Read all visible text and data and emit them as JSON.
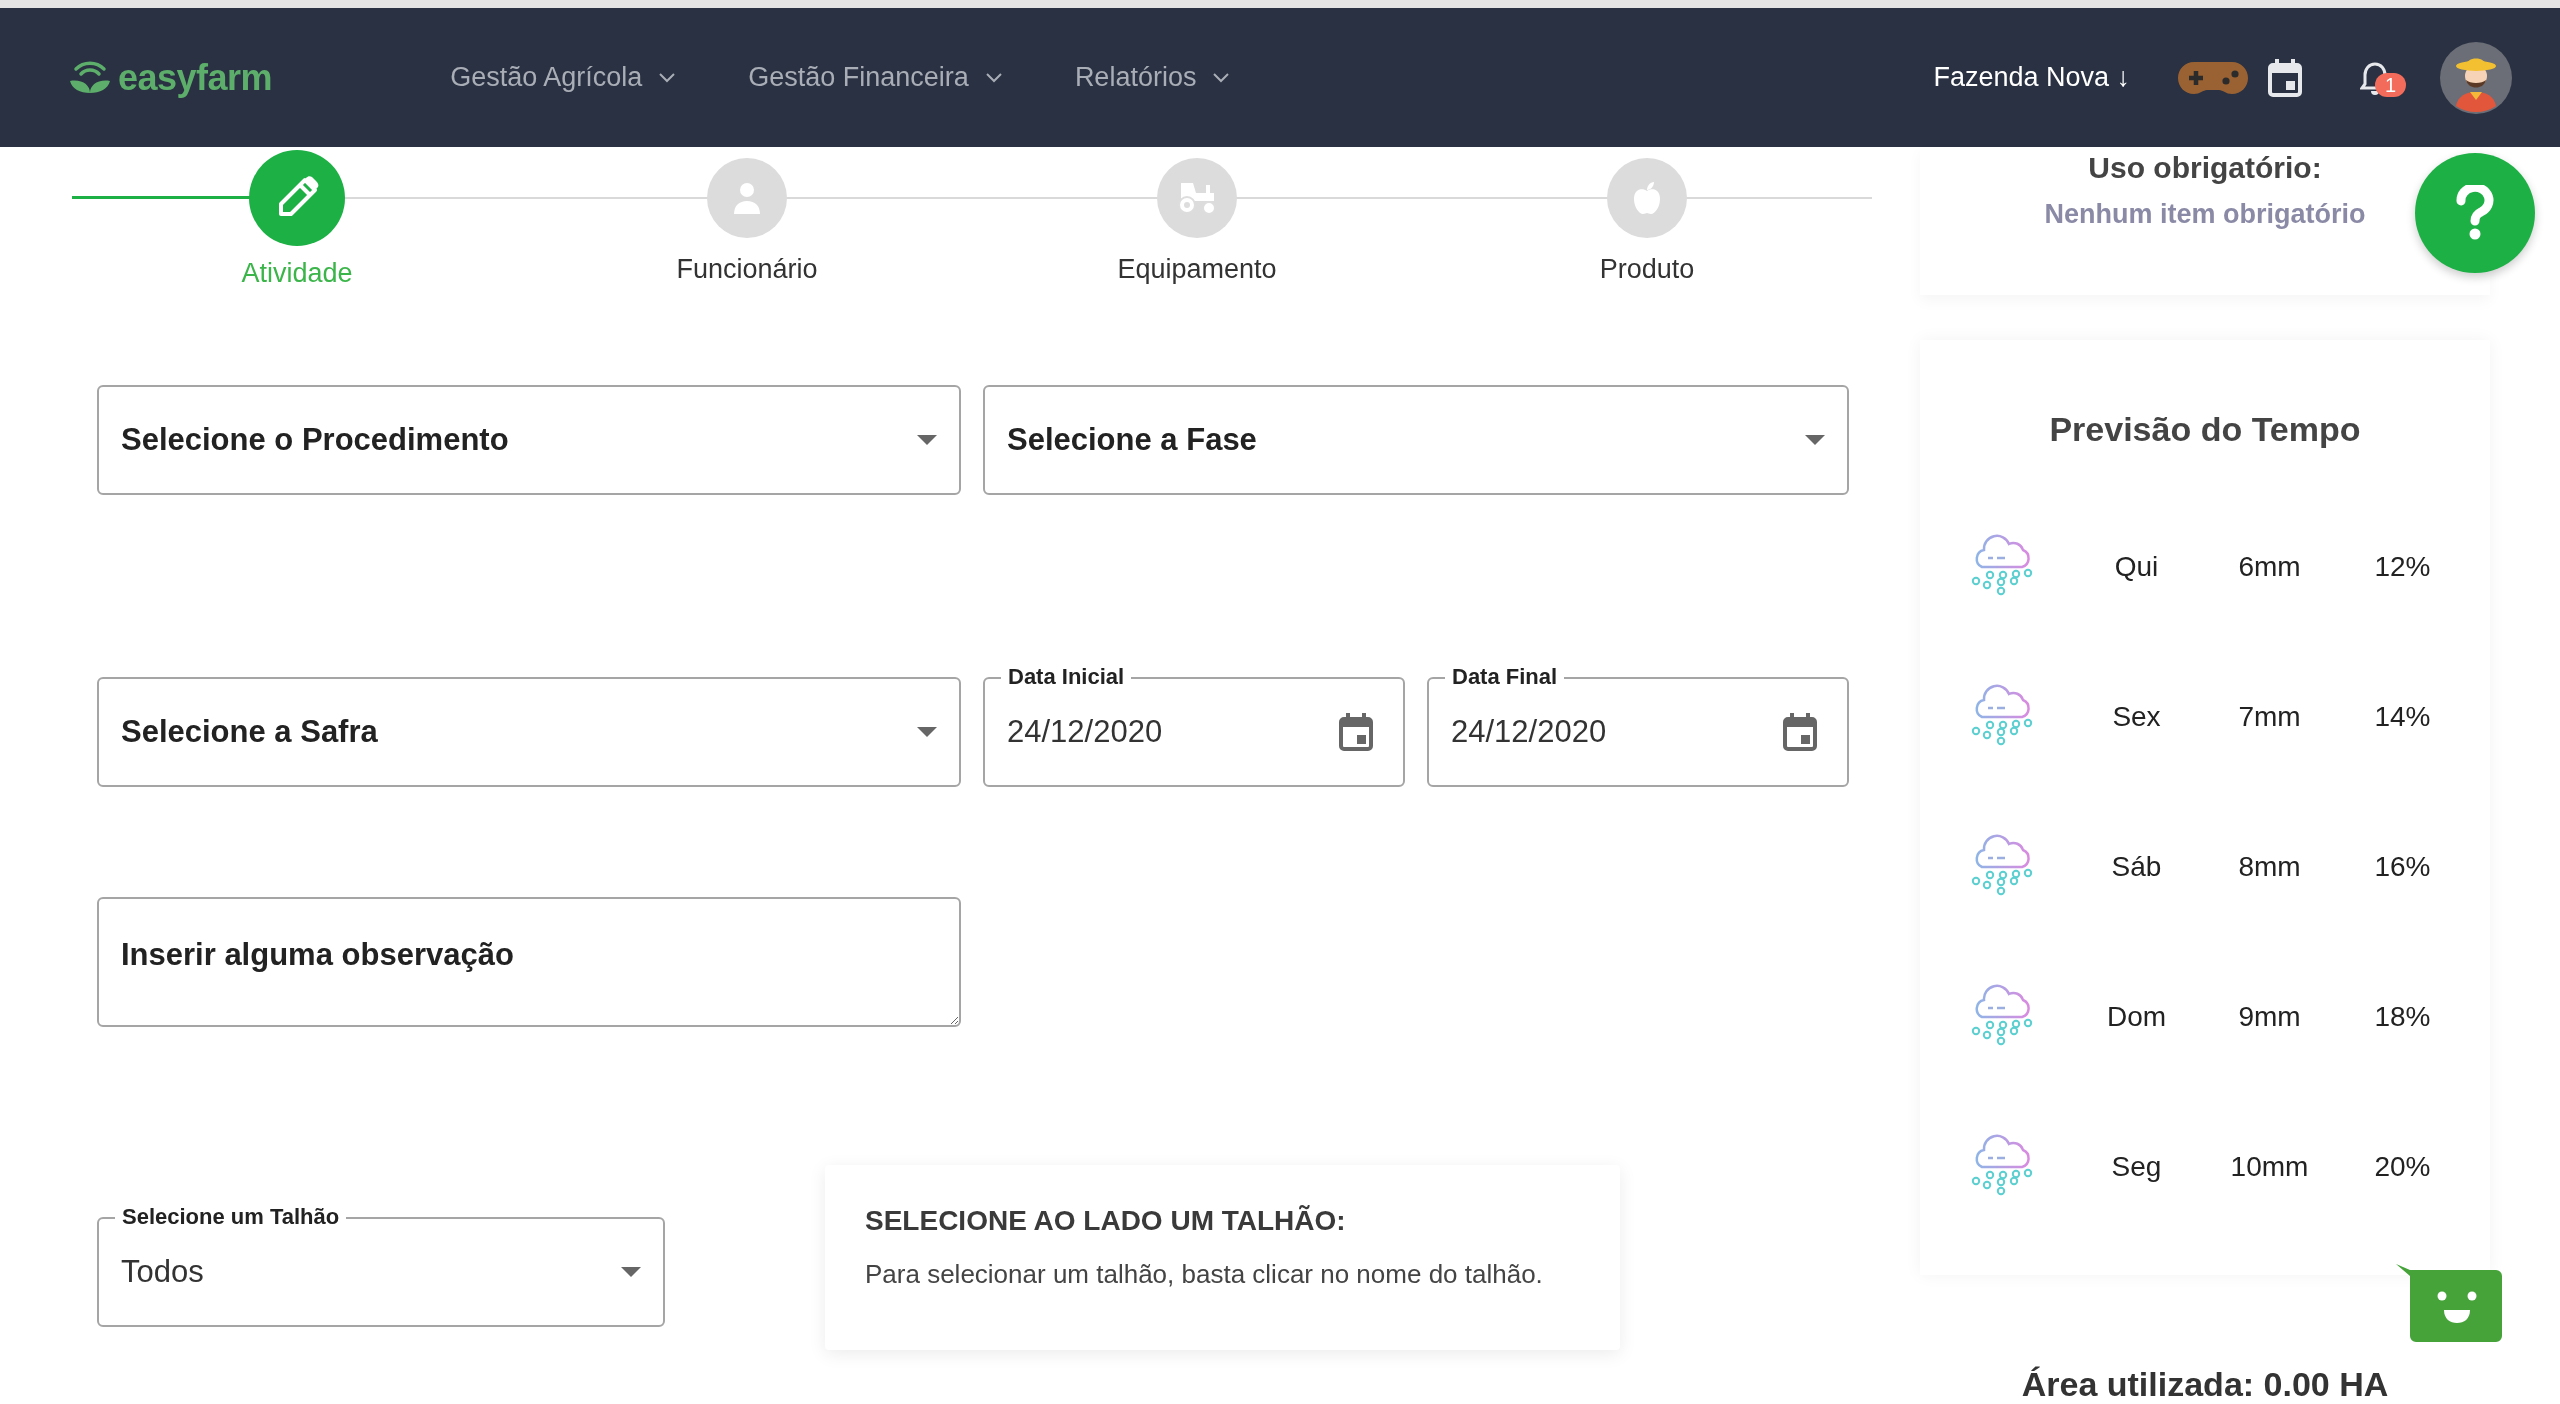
{
  "header": {
    "logo": "easyfarm",
    "nav": [
      {
        "label": "Gestão Agrícola"
      },
      {
        "label": "Gestão Financeira"
      },
      {
        "label": "Relatórios"
      }
    ],
    "farm": "Fazenda Nova ↓",
    "notification_count": "1"
  },
  "stepper": [
    {
      "label": "Atividade",
      "selected": true,
      "kind": "pencil"
    },
    {
      "label": "Funcionário",
      "selected": false,
      "kind": "person"
    },
    {
      "label": "Equipamento",
      "selected": false,
      "kind": "tractor"
    },
    {
      "label": "Produto",
      "selected": false,
      "kind": "apple"
    }
  ],
  "form": {
    "procedure": {
      "label": "Selecione o Procedimento"
    },
    "phase": {
      "label": "Selecione a Fase"
    },
    "harvest": {
      "label": "Selecione a Safra"
    },
    "start_date": {
      "label": "Data Inicial",
      "value": "24/12/2020"
    },
    "end_date": {
      "label": "Data Final",
      "value": "24/12/2020"
    },
    "notes": {
      "placeholder": "Inserir alguma observação"
    },
    "plot": {
      "label": "Selecione um Talhão",
      "value": "Todos"
    }
  },
  "plot_info": {
    "title": "SELECIONE AO LADO UM TALHÃO:",
    "text": "Para selecionar um talhão, basta clicar no nome do talhão."
  },
  "required_use": {
    "title": "Uso obrigatório:",
    "text": "Nenhum item obrigatório"
  },
  "weather": {
    "title": "Previsão do Tempo",
    "days": [
      {
        "day": "Qui",
        "rain": "6mm",
        "chance": "12%"
      },
      {
        "day": "Sex",
        "rain": "7mm",
        "chance": "14%"
      },
      {
        "day": "Sáb",
        "rain": "8mm",
        "chance": "16%"
      },
      {
        "day": "Dom",
        "rain": "9mm",
        "chance": "18%"
      },
      {
        "day": "Seg",
        "rain": "10mm",
        "chance": "20%"
      }
    ]
  },
  "area_used": "Área utilizada: 0.00 HA"
}
